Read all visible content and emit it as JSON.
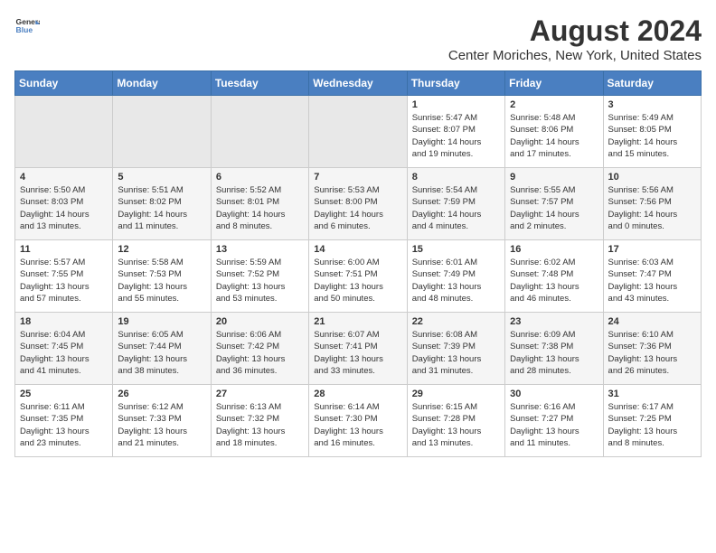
{
  "header": {
    "logo": {
      "general": "General",
      "blue": "Blue"
    },
    "title": "August 2024",
    "subtitle": "Center Moriches, New York, United States"
  },
  "days_of_week": [
    "Sunday",
    "Monday",
    "Tuesday",
    "Wednesday",
    "Thursday",
    "Friday",
    "Saturday"
  ],
  "weeks": [
    [
      {
        "day": "",
        "info": ""
      },
      {
        "day": "",
        "info": ""
      },
      {
        "day": "",
        "info": ""
      },
      {
        "day": "",
        "info": ""
      },
      {
        "day": "1",
        "info": "Sunrise: 5:47 AM\nSunset: 8:07 PM\nDaylight: 14 hours\nand 19 minutes."
      },
      {
        "day": "2",
        "info": "Sunrise: 5:48 AM\nSunset: 8:06 PM\nDaylight: 14 hours\nand 17 minutes."
      },
      {
        "day": "3",
        "info": "Sunrise: 5:49 AM\nSunset: 8:05 PM\nDaylight: 14 hours\nand 15 minutes."
      }
    ],
    [
      {
        "day": "4",
        "info": "Sunrise: 5:50 AM\nSunset: 8:03 PM\nDaylight: 14 hours\nand 13 minutes."
      },
      {
        "day": "5",
        "info": "Sunrise: 5:51 AM\nSunset: 8:02 PM\nDaylight: 14 hours\nand 11 minutes."
      },
      {
        "day": "6",
        "info": "Sunrise: 5:52 AM\nSunset: 8:01 PM\nDaylight: 14 hours\nand 8 minutes."
      },
      {
        "day": "7",
        "info": "Sunrise: 5:53 AM\nSunset: 8:00 PM\nDaylight: 14 hours\nand 6 minutes."
      },
      {
        "day": "8",
        "info": "Sunrise: 5:54 AM\nSunset: 7:59 PM\nDaylight: 14 hours\nand 4 minutes."
      },
      {
        "day": "9",
        "info": "Sunrise: 5:55 AM\nSunset: 7:57 PM\nDaylight: 14 hours\nand 2 minutes."
      },
      {
        "day": "10",
        "info": "Sunrise: 5:56 AM\nSunset: 7:56 PM\nDaylight: 14 hours\nand 0 minutes."
      }
    ],
    [
      {
        "day": "11",
        "info": "Sunrise: 5:57 AM\nSunset: 7:55 PM\nDaylight: 13 hours\nand 57 minutes."
      },
      {
        "day": "12",
        "info": "Sunrise: 5:58 AM\nSunset: 7:53 PM\nDaylight: 13 hours\nand 55 minutes."
      },
      {
        "day": "13",
        "info": "Sunrise: 5:59 AM\nSunset: 7:52 PM\nDaylight: 13 hours\nand 53 minutes."
      },
      {
        "day": "14",
        "info": "Sunrise: 6:00 AM\nSunset: 7:51 PM\nDaylight: 13 hours\nand 50 minutes."
      },
      {
        "day": "15",
        "info": "Sunrise: 6:01 AM\nSunset: 7:49 PM\nDaylight: 13 hours\nand 48 minutes."
      },
      {
        "day": "16",
        "info": "Sunrise: 6:02 AM\nSunset: 7:48 PM\nDaylight: 13 hours\nand 46 minutes."
      },
      {
        "day": "17",
        "info": "Sunrise: 6:03 AM\nSunset: 7:47 PM\nDaylight: 13 hours\nand 43 minutes."
      }
    ],
    [
      {
        "day": "18",
        "info": "Sunrise: 6:04 AM\nSunset: 7:45 PM\nDaylight: 13 hours\nand 41 minutes."
      },
      {
        "day": "19",
        "info": "Sunrise: 6:05 AM\nSunset: 7:44 PM\nDaylight: 13 hours\nand 38 minutes."
      },
      {
        "day": "20",
        "info": "Sunrise: 6:06 AM\nSunset: 7:42 PM\nDaylight: 13 hours\nand 36 minutes."
      },
      {
        "day": "21",
        "info": "Sunrise: 6:07 AM\nSunset: 7:41 PM\nDaylight: 13 hours\nand 33 minutes."
      },
      {
        "day": "22",
        "info": "Sunrise: 6:08 AM\nSunset: 7:39 PM\nDaylight: 13 hours\nand 31 minutes."
      },
      {
        "day": "23",
        "info": "Sunrise: 6:09 AM\nSunset: 7:38 PM\nDaylight: 13 hours\nand 28 minutes."
      },
      {
        "day": "24",
        "info": "Sunrise: 6:10 AM\nSunset: 7:36 PM\nDaylight: 13 hours\nand 26 minutes."
      }
    ],
    [
      {
        "day": "25",
        "info": "Sunrise: 6:11 AM\nSunset: 7:35 PM\nDaylight: 13 hours\nand 23 minutes."
      },
      {
        "day": "26",
        "info": "Sunrise: 6:12 AM\nSunset: 7:33 PM\nDaylight: 13 hours\nand 21 minutes."
      },
      {
        "day": "27",
        "info": "Sunrise: 6:13 AM\nSunset: 7:32 PM\nDaylight: 13 hours\nand 18 minutes."
      },
      {
        "day": "28",
        "info": "Sunrise: 6:14 AM\nSunset: 7:30 PM\nDaylight: 13 hours\nand 16 minutes."
      },
      {
        "day": "29",
        "info": "Sunrise: 6:15 AM\nSunset: 7:28 PM\nDaylight: 13 hours\nand 13 minutes."
      },
      {
        "day": "30",
        "info": "Sunrise: 6:16 AM\nSunset: 7:27 PM\nDaylight: 13 hours\nand 11 minutes."
      },
      {
        "day": "31",
        "info": "Sunrise: 6:17 AM\nSunset: 7:25 PM\nDaylight: 13 hours\nand 8 minutes."
      }
    ]
  ]
}
